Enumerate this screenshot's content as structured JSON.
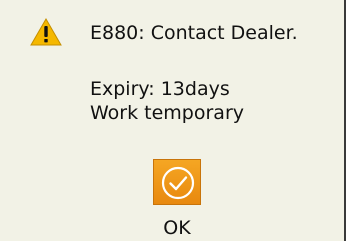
{
  "dialog": {
    "error_text": "E880: Contact Dealer.",
    "details": [
      "Expiry: 13days",
      "Work temporary"
    ],
    "ok_label": "OK",
    "icons": {
      "warning": "warning-icon",
      "ok": "check-circle-icon"
    },
    "colors": {
      "background": "#f2f2e6",
      "warning_fill": "#f5b800",
      "ok_button": "#f09a1a"
    }
  }
}
